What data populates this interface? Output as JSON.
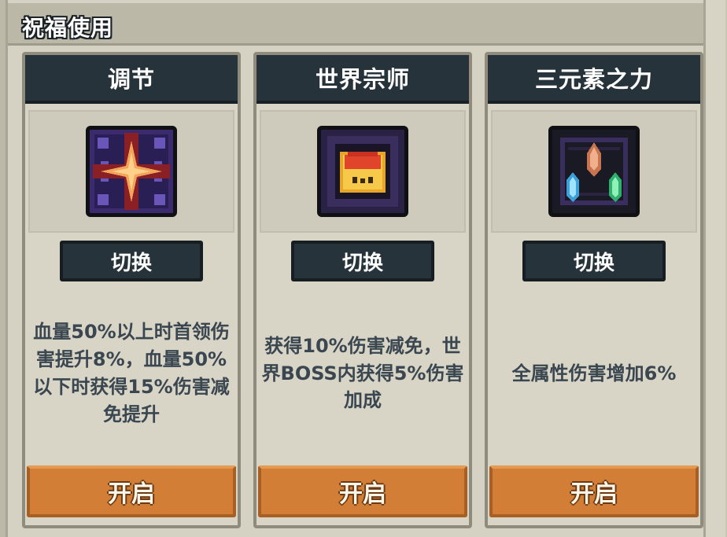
{
  "header": {
    "title": "祝福使用"
  },
  "cards": [
    {
      "title": "调节",
      "icon": "star-cross-icon",
      "switch_label": "切换",
      "description": "血量50%以上时首领伤害提升8%，血量50%以下时获得15%伤害减免提升",
      "open_label": "开启"
    },
    {
      "title": "世界宗师",
      "icon": "golden-crown-icon",
      "switch_label": "切换",
      "description": "获得10%伤害减免，世界BOSS内获得5%伤害加成",
      "open_label": "开启"
    },
    {
      "title": "三元素之力",
      "icon": "three-elements-icon",
      "switch_label": "切换",
      "description": "全属性伤害增加6%",
      "open_label": "开启"
    }
  ],
  "colors": {
    "panel_bg": "#d6d2c3",
    "title_bar": "#27333a",
    "open_button": "#d27e36",
    "desc_text": "#3a4650"
  }
}
